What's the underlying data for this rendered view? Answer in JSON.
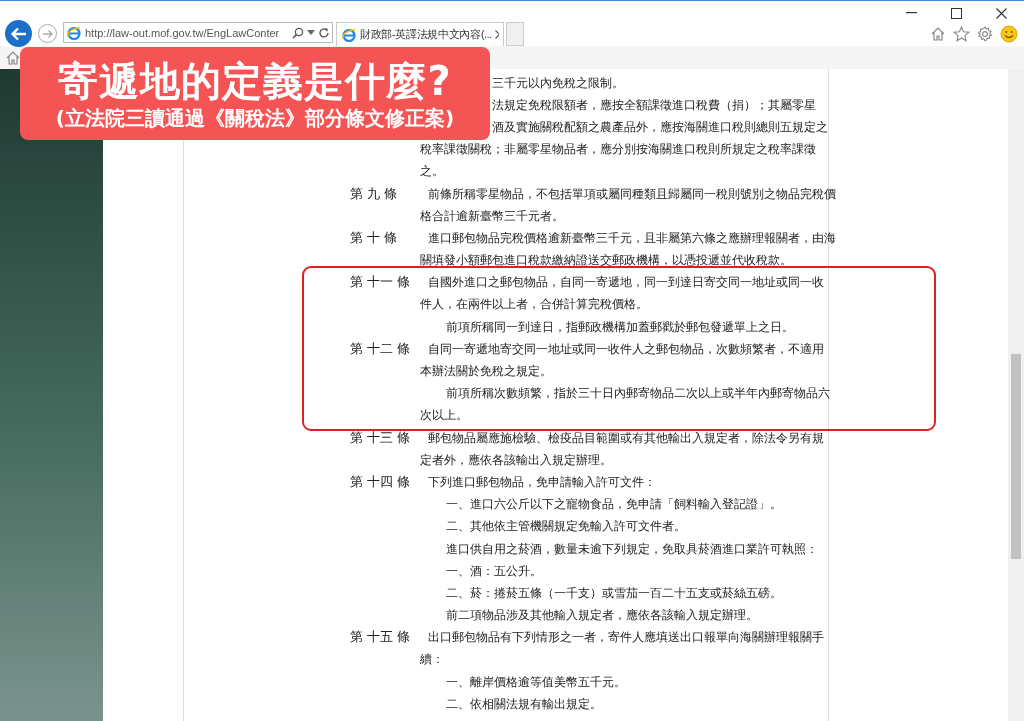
{
  "browser": {
    "address": "http://law-out.mof.gov.tw/EngLawConter",
    "tab_title": "財政部-英譯法規中文內容(..."
  },
  "banner": {
    "title": "寄遞地的定義是什麼?",
    "subtitle": "(立法院三讀通過《關稅法》部分條文修正案)"
  },
  "document": {
    "lines": [
      {
        "kind": "partial",
        "text": "三千元以內免稅之限制。"
      },
      {
        "kind": "partial",
        "text": "法規定免稅限額者，應按全額課徵進口稅費（捐）；其屬零星"
      },
      {
        "kind": "partial",
        "text": "酒及實施關稅配額之農產品外，應按海關進口稅則總則五規定之"
      },
      {
        "kind": "cont",
        "text": "稅率課徵關稅；非屬零星物品者，應分別按海關進口稅則所規定之稅率課徵"
      },
      {
        "kind": "cont",
        "text": "之。"
      },
      {
        "kind": "first",
        "label": "第 九 條",
        "text": "前條所稱零星物品，不包括單項或屬同種類且歸屬同一稅則號別之物品完稅價"
      },
      {
        "kind": "cont",
        "text": "格合計逾新臺幣三千元者。"
      },
      {
        "kind": "first",
        "label": "第 十 條",
        "text": "進口郵包物品完稅價格逾新臺幣三千元，且非屬第六條之應辦理報關者，由海"
      },
      {
        "kind": "cont",
        "text": "關填發小額郵包進口稅款繳納證送交郵政機構，以憑投遞並代收稅款。"
      },
      {
        "kind": "first",
        "boxed": true,
        "label": "第 十一 條",
        "text": "自國外進口之郵包物品，自同一寄遞地，同一到達日寄交同一地址或同一收"
      },
      {
        "kind": "cont",
        "boxed": true,
        "text": "件人，在兩件以上者，合併計算完稅價格。"
      },
      {
        "kind": "indent",
        "boxed": true,
        "text": "前項所稱同一到達日，指郵政機構加蓋郵戳於郵包發遞單上之日。"
      },
      {
        "kind": "first",
        "boxed": true,
        "label": "第 十二 條",
        "text": "自同一寄遞地寄交同一地址或同一收件人之郵包物品，次數頻繁者，不適用"
      },
      {
        "kind": "cont",
        "boxed": true,
        "text": "本辦法關於免稅之規定。"
      },
      {
        "kind": "indent",
        "boxed": true,
        "text": "前項所稱次數頻繁，指於三十日內郵寄物品二次以上或半年內郵寄物品六"
      },
      {
        "kind": "cont",
        "boxed": true,
        "text": "次以上。"
      },
      {
        "kind": "first",
        "label": "第 十三 條",
        "text": "郵包物品屬應施檢驗、檢疫品目範圍或有其他輸出入規定者，除法令另有規"
      },
      {
        "kind": "cont",
        "text": "定者外，應依各該輸出入規定辦理。"
      },
      {
        "kind": "first",
        "label": "第 十四 條",
        "text": "下列進口郵包物品，免申請輸入許可文件："
      },
      {
        "kind": "indent",
        "text": "一、進口六公斤以下之寵物食品，免申請「飼料輸入登記證」。"
      },
      {
        "kind": "indent",
        "text": "二、其他依主管機關規定免輸入許可文件者。"
      },
      {
        "kind": "indent",
        "text": "進口供自用之菸酒，數量未逾下列規定，免取具菸酒進口業許可執照："
      },
      {
        "kind": "indent",
        "text": "一、酒：五公升。"
      },
      {
        "kind": "indent",
        "text": "二、菸：捲菸五條（一千支）或雪茄一百二十五支或菸絲五磅。"
      },
      {
        "kind": "indent",
        "text": "前二項物品涉及其他輸入規定者，應依各該輸入規定辦理。"
      },
      {
        "kind": "first",
        "label": "第 十五 條",
        "text": "出口郵包物品有下列情形之一者，寄件人應填送出口報單向海關辦理報關手"
      },
      {
        "kind": "cont",
        "text": "續："
      },
      {
        "kind": "indent",
        "text": "一、離岸價格逾等值美幣五千元。"
      },
      {
        "kind": "indent",
        "text": "二、依相關法規有輸出規定。"
      }
    ]
  }
}
